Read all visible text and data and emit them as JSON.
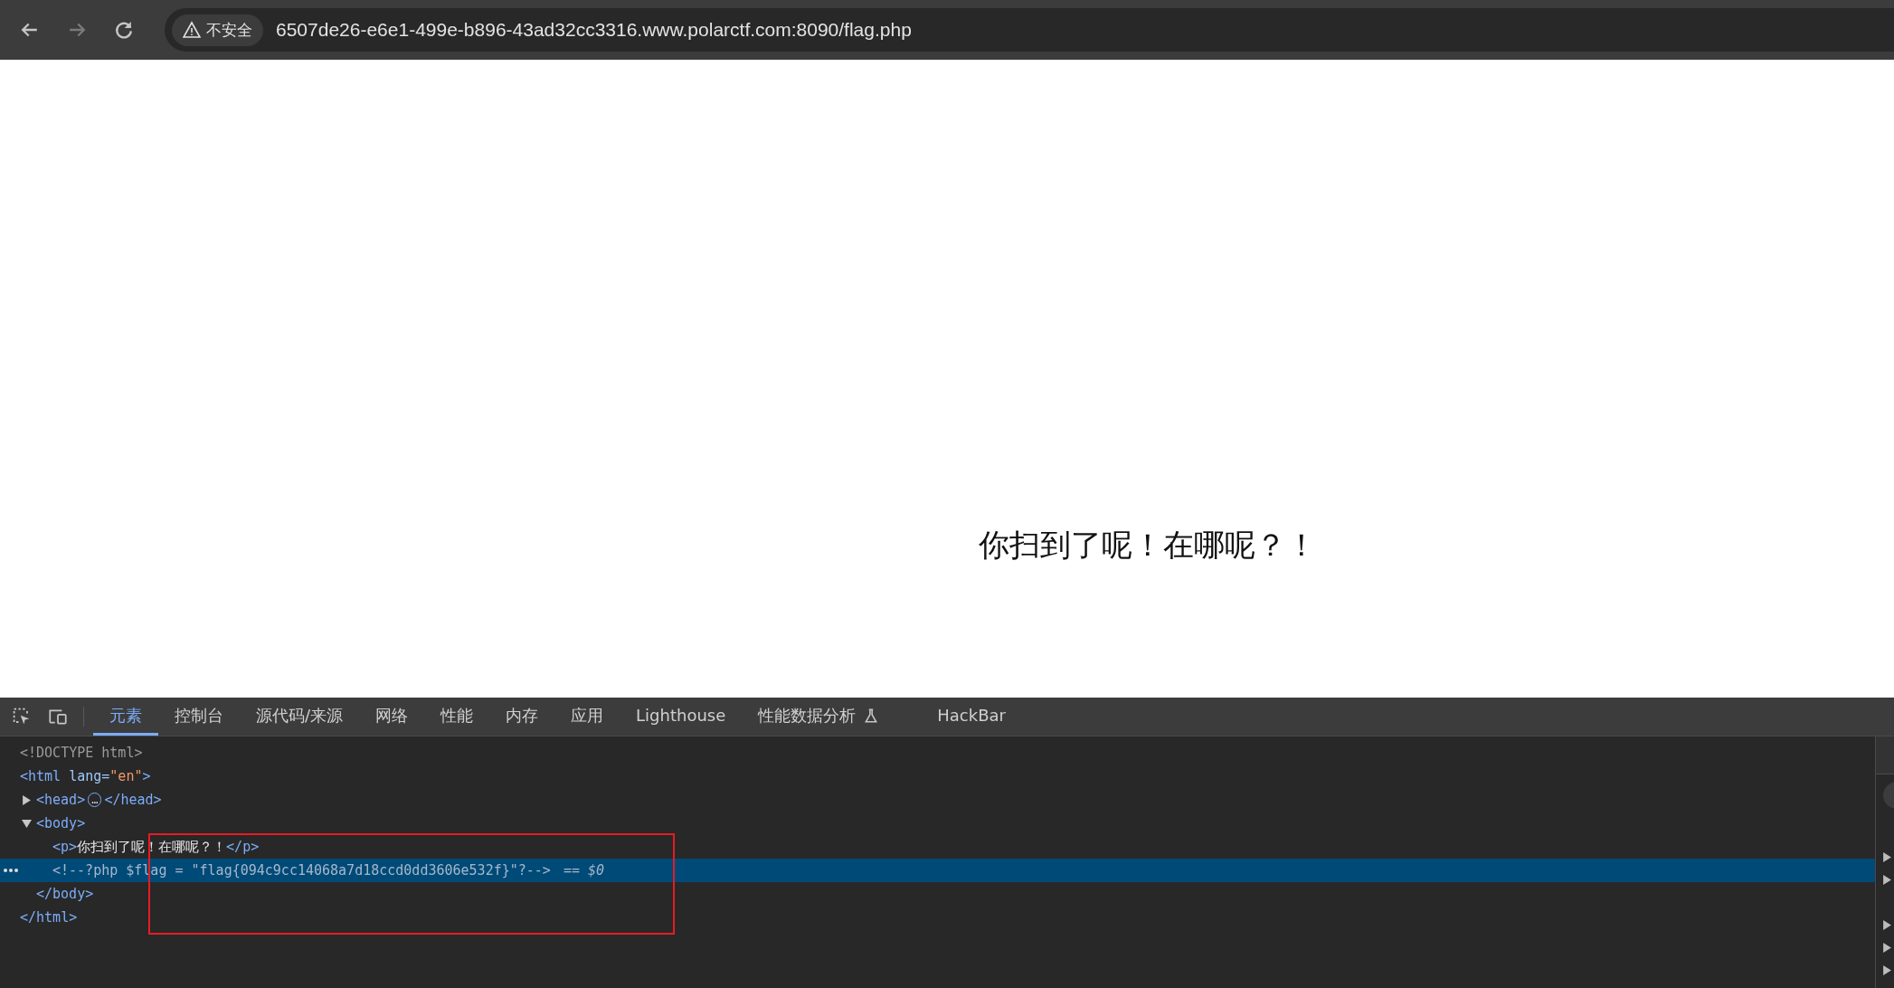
{
  "browser": {
    "security_label": "不安全",
    "url": "6507de26-e6e1-499e-b896-43ad32cc3316.www.polarctf.com:8090/flag.php"
  },
  "page": {
    "text": "你扫到了呢！在哪呢？！"
  },
  "devtools": {
    "tabs": [
      {
        "label": "元素",
        "selected": true,
        "experimental": false
      },
      {
        "label": "控制台",
        "selected": false,
        "experimental": false
      },
      {
        "label": "源代码/来源",
        "selected": false,
        "experimental": false
      },
      {
        "label": "网络",
        "selected": false,
        "experimental": false
      },
      {
        "label": "性能",
        "selected": false,
        "experimental": false
      },
      {
        "label": "内存",
        "selected": false,
        "experimental": false
      },
      {
        "label": "应用",
        "selected": false,
        "experimental": false
      },
      {
        "label": "Lighthouse",
        "selected": false,
        "experimental": false
      },
      {
        "label": "性能数据分析",
        "selected": false,
        "experimental": true
      },
      {
        "label": "HackBar",
        "selected": false,
        "experimental": false
      }
    ],
    "dom": [
      {
        "selected": false,
        "tokens": [
          {
            "kind": "doctype",
            "text": "<!DOCTYPE html>"
          }
        ]
      },
      {
        "selected": false,
        "tokens": [
          {
            "kind": "tag",
            "text": "<html"
          },
          {
            "kind": "attr",
            "text": " lang="
          },
          {
            "kind": "value",
            "text": "\"en\""
          },
          {
            "kind": "tag",
            "text": ">"
          }
        ],
        "closing": [
          {
            "kind": "tag",
            "text": "</html>"
          }
        ],
        "children": [
          {
            "selected": false,
            "expanded": false,
            "tokens": [
              {
                "kind": "tag",
                "text": "<head>"
              },
              {
                "kind": "ellipsis",
                "text": "…"
              },
              {
                "kind": "tag",
                "text": "</head>"
              }
            ]
          },
          {
            "selected": false,
            "expanded": true,
            "tokens": [
              {
                "kind": "tag",
                "text": "<body>"
              }
            ],
            "closing": [
              {
                "kind": "tag",
                "text": "</body>"
              }
            ],
            "children": [
              {
                "selected": false,
                "tokens": [
                  {
                    "kind": "tag",
                    "text": "<p>"
                  },
                  {
                    "kind": "text",
                    "text": "你扫到了呢！在哪呢？！"
                  },
                  {
                    "kind": "tag",
                    "text": "</p>"
                  }
                ]
              },
              {
                "selected": true,
                "tokens": [
                  {
                    "kind": "comment",
                    "text": "<!--?php $flag = \"flag{094c9cc14068a7d18ccd0dd3606e532f}\"?-->"
                  },
                  {
                    "kind": "marker",
                    "text": "== $0"
                  }
                ]
              }
            ]
          }
        ]
      }
    ]
  }
}
